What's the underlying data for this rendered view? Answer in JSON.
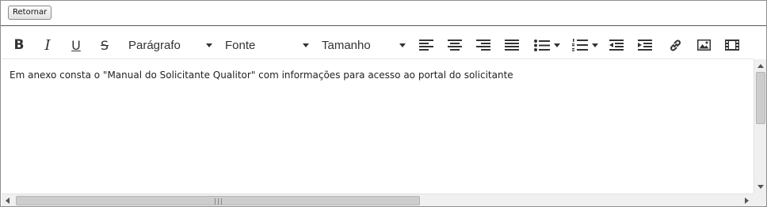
{
  "topbar": {
    "return_label": "Retornar"
  },
  "toolbar": {
    "bold_label": "B",
    "italic_label": "I",
    "underline_label": "U",
    "strike_label": "S",
    "paragraph_label": "Parágrafo",
    "font_label": "Fonte",
    "size_label": "Tamanho",
    "icons": [
      "bold-icon",
      "italic-icon",
      "underline-icon",
      "strikethrough-icon",
      "align-left-icon",
      "align-center-icon",
      "align-right-icon",
      "align-justify-icon",
      "bullet-list-icon",
      "numbered-list-icon",
      "outdent-icon",
      "indent-icon",
      "link-icon",
      "image-icon",
      "video-icon"
    ]
  },
  "editor": {
    "content": "Em anexo consta o \"Manual do Solicitante Qualitor\" com informações para acesso ao portal do solicitante"
  },
  "scroll": {
    "grip": "|||"
  }
}
